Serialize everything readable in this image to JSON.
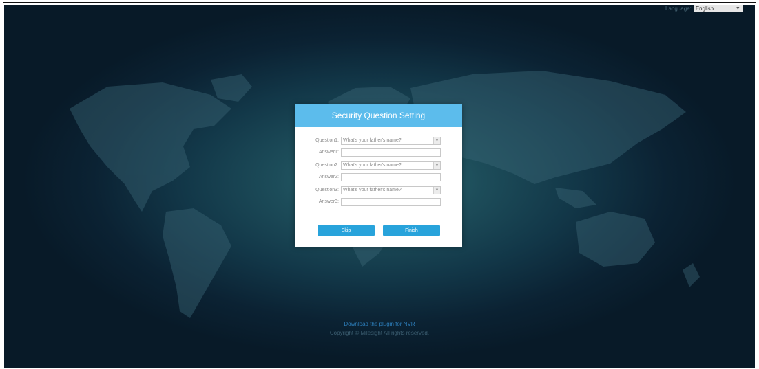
{
  "language": {
    "label": "Language:",
    "selected": "English"
  },
  "dialog": {
    "title": "Security Question Setting",
    "questions": [
      {
        "question_label": "Question1:",
        "question_value": "What's your father's name?",
        "answer_label": "Answer1:",
        "answer_value": ""
      },
      {
        "question_label": "Question2:",
        "question_value": "What's your father's name?",
        "answer_label": "Answer2:",
        "answer_value": ""
      },
      {
        "question_label": "Question3:",
        "question_value": "What's your father's name?",
        "answer_label": "Answer3:",
        "answer_value": ""
      }
    ],
    "skip_label": "Skip",
    "finish_label": "Finish"
  },
  "footer": {
    "plugin_link": "Download the plugin for NVR",
    "copyright": "Copyright © Milesight All rights reserved."
  },
  "colors": {
    "header": "#5cbcec",
    "button": "#28a3db",
    "link": "#2d7fbc"
  },
  "icons": {
    "dropdown": "chevron-down-icon"
  }
}
